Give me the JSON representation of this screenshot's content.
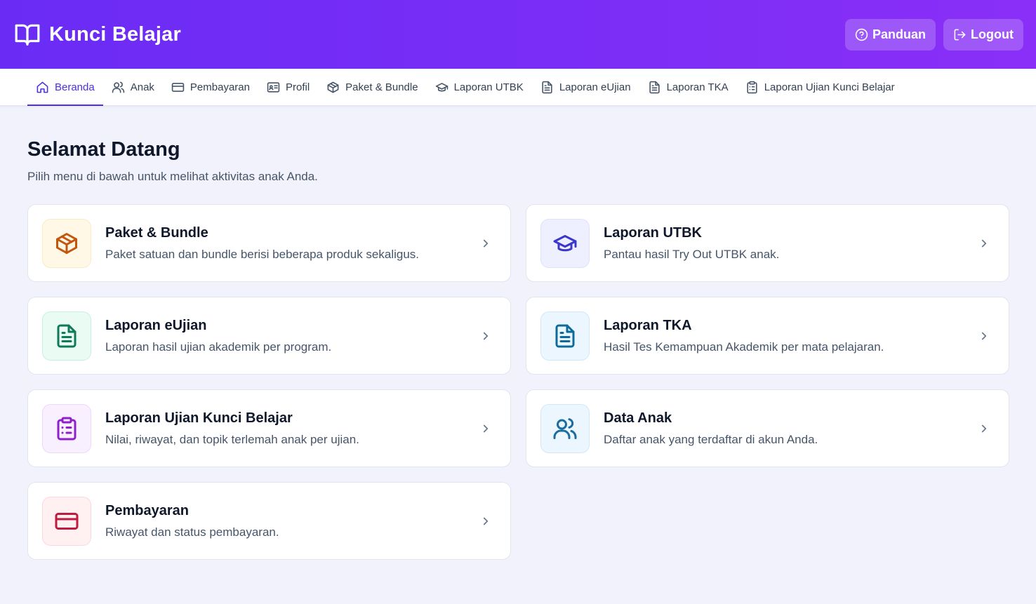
{
  "app": {
    "title": "Kunci Belajar",
    "actions": {
      "panduan": "Panduan",
      "logout": "Logout"
    }
  },
  "nav": {
    "items": [
      {
        "label": "Beranda",
        "icon": "home-icon",
        "active": true
      },
      {
        "label": "Anak",
        "icon": "users-icon"
      },
      {
        "label": "Pembayaran",
        "icon": "credit-card-icon"
      },
      {
        "label": "Profil",
        "icon": "id-card-icon"
      },
      {
        "label": "Paket & Bundle",
        "icon": "package-icon"
      },
      {
        "label": "Laporan UTBK",
        "icon": "graduation-cap-icon"
      },
      {
        "label": "Laporan eUjian",
        "icon": "file-text-icon"
      },
      {
        "label": "Laporan TKA",
        "icon": "file-text-icon"
      },
      {
        "label": "Laporan Ujian Kunci Belajar",
        "icon": "clipboard-list-icon"
      }
    ]
  },
  "main": {
    "title": "Selamat Datang",
    "subtitle": "Pilih menu di bawah untuk melihat aktivitas anak Anda.",
    "cards": [
      {
        "title": "Paket & Bundle",
        "desc": "Paket satuan dan bundle berisi beberapa produk sekaligus.",
        "icon": "package-icon",
        "accent": "#c2570c"
      },
      {
        "title": "Laporan UTBK",
        "desc": "Pantau hasil Try Out UTBK anak.",
        "icon": "graduation-cap-icon",
        "accent": "#3b38c9"
      },
      {
        "title": "Laporan eUjian",
        "desc": "Laporan hasil ujian akademik per program.",
        "icon": "file-text-icon",
        "accent": "#0f7a5a"
      },
      {
        "title": "Laporan TKA",
        "desc": "Hasil Tes Kemampuan Akademik per mata pelajaran.",
        "icon": "file-text-icon",
        "accent": "#0d6b9a"
      },
      {
        "title": "Laporan Ujian Kunci Belajar",
        "desc": "Nilai, riwayat, dan topik terlemah anak per ujian.",
        "icon": "clipboard-list-icon",
        "accent": "#8f1fc9"
      },
      {
        "title": "Data Anak",
        "desc": "Daftar anak yang terdaftar di akun Anda.",
        "icon": "users-icon",
        "accent": "#1c6c9f"
      },
      {
        "title": "Pembayaran",
        "desc": "Riwayat dan status pembayaran.",
        "icon": "credit-card-icon",
        "accent": "#c01a3f"
      }
    ]
  },
  "colors": {
    "header_start": "#6a2cf5",
    "header_end": "#8a2ff7",
    "nav_active": "#4f2ee6",
    "background": "#f1f2fb"
  }
}
